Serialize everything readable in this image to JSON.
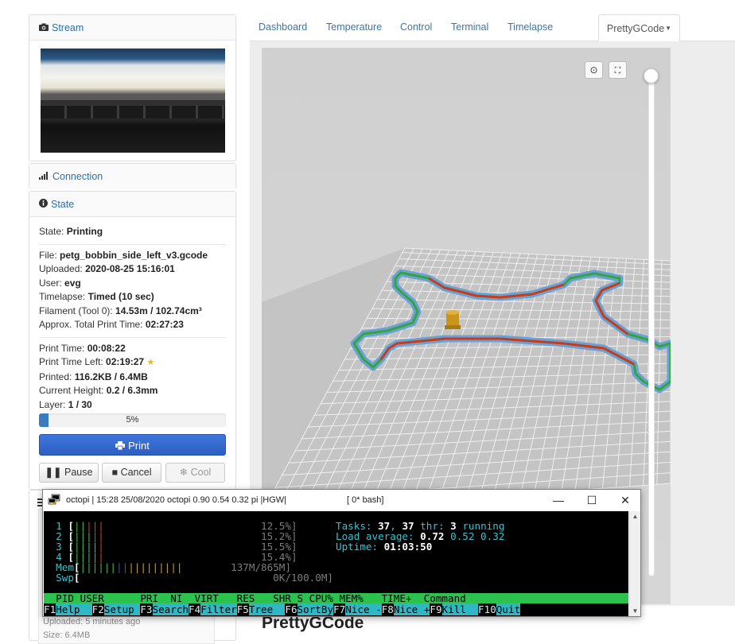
{
  "left": {
    "stream": {
      "icon": "camera-icon",
      "title": "Stream"
    },
    "connection": {
      "icon": "signal-icon",
      "title": "Connection"
    },
    "state": {
      "icon": "info-icon",
      "title": "State",
      "state_label": "State:",
      "state_value": "Printing",
      "file_label": "File:",
      "file_value": "petg_bobbin_side_left_v3.gcode",
      "uploaded_label": "Uploaded:",
      "uploaded_value": "2020-08-25 15:16:01",
      "user_label": "User:",
      "user_value": "evg",
      "timelapse_label": "Timelapse:",
      "timelapse_value": "Timed (10 sec)",
      "filament_label": "Filament (Tool 0):",
      "filament_value": "14.53m / 102.74cm³",
      "approx_label": "Approx. Total Print Time:",
      "approx_value": "02:27:23",
      "print_time_label": "Print Time:",
      "print_time_value": "00:08:22",
      "time_left_label": "Print Time Left:",
      "time_left_value": "02:19:27",
      "printed_label": "Printed:",
      "printed_value": "116.2KB / 6.4MB",
      "height_label": "Current Height:",
      "height_value": "0.2 / 6.3mm",
      "layer_label": "Layer:",
      "layer_value": "1 / 30",
      "progress_percent": 5,
      "progress_text": "5%"
    },
    "buttons": {
      "print": "Print",
      "pause": "Pause",
      "cancel": "Cancel",
      "cool": "Cool"
    },
    "files": {
      "uploaded_meta": "Uploaded: 5 minutes ago",
      "size_meta": "Size: 6.4MB"
    }
  },
  "tabs": [
    {
      "label": "Dashboard"
    },
    {
      "label": "Temperature"
    },
    {
      "label": "Control"
    },
    {
      "label": "Terminal"
    },
    {
      "label": "Timelapse"
    },
    {
      "label": "PrettyGCode",
      "active": true
    }
  ],
  "viewer": {
    "title": "PrettyGCode",
    "settings_icon": "settings-icon",
    "fullscreen_icon": "fullscreen-icon",
    "colors": {
      "blue_shell": "#6aa2d6",
      "green_inner": "#36a43c",
      "red_perimeter": "#cc3a1c",
      "part": "#c9951a",
      "grid_bg": "#d2d2d2",
      "grid_line": "#f3f3f3"
    }
  },
  "terminal": {
    "title": "octopi | 15:28 25/08/2020 octopi 0.90 0.54 0.32 pi |HGW|",
    "session": "[ 0* bash]",
    "minimize": "—",
    "maximize": "☐",
    "close": "✕",
    "cpus": [
      {
        "n": "1",
        "pct": "12.5%]"
      },
      {
        "n": "2",
        "pct": "15.2%]"
      },
      {
        "n": "3",
        "pct": "15.5%]"
      },
      {
        "n": "4",
        "pct": "15.4%]"
      }
    ],
    "mem_label": "Mem",
    "mem_value": "137M/865M]",
    "swp_label": "Swp",
    "swp_value": "0K/100.0M]",
    "tasks_label": "Tasks:",
    "tasks_value": "37",
    "tasks_sep": ",",
    "thr_value": "37",
    "thr_label": "thr:",
    "running_value": "3",
    "running_label": "running",
    "load_label": "Load average:",
    "load_1": "0.72",
    "load_5": "0.52",
    "load_15": "0.32",
    "uptime_label": "Uptime:",
    "uptime_value": "01:03:50",
    "header_columns": "  PID USER      PRI  NI  VIRT   RES   SHR S CPU% MEM%   TIME+  Command",
    "fn_keys": [
      {
        "key": "F1",
        "label": "Help  "
      },
      {
        "key": "F2",
        "label": "Setup "
      },
      {
        "key": "F3",
        "label": "Search"
      },
      {
        "key": "F4",
        "label": "Filter"
      },
      {
        "key": "F5",
        "label": "Tree  "
      },
      {
        "key": "F6",
        "label": "SortBy"
      },
      {
        "key": "F7",
        "label": "Nice -"
      },
      {
        "key": "F8",
        "label": "Nice +"
      },
      {
        "key": "F9",
        "label": "Kill  "
      },
      {
        "key": "F10",
        "label": "Quit"
      }
    ]
  }
}
